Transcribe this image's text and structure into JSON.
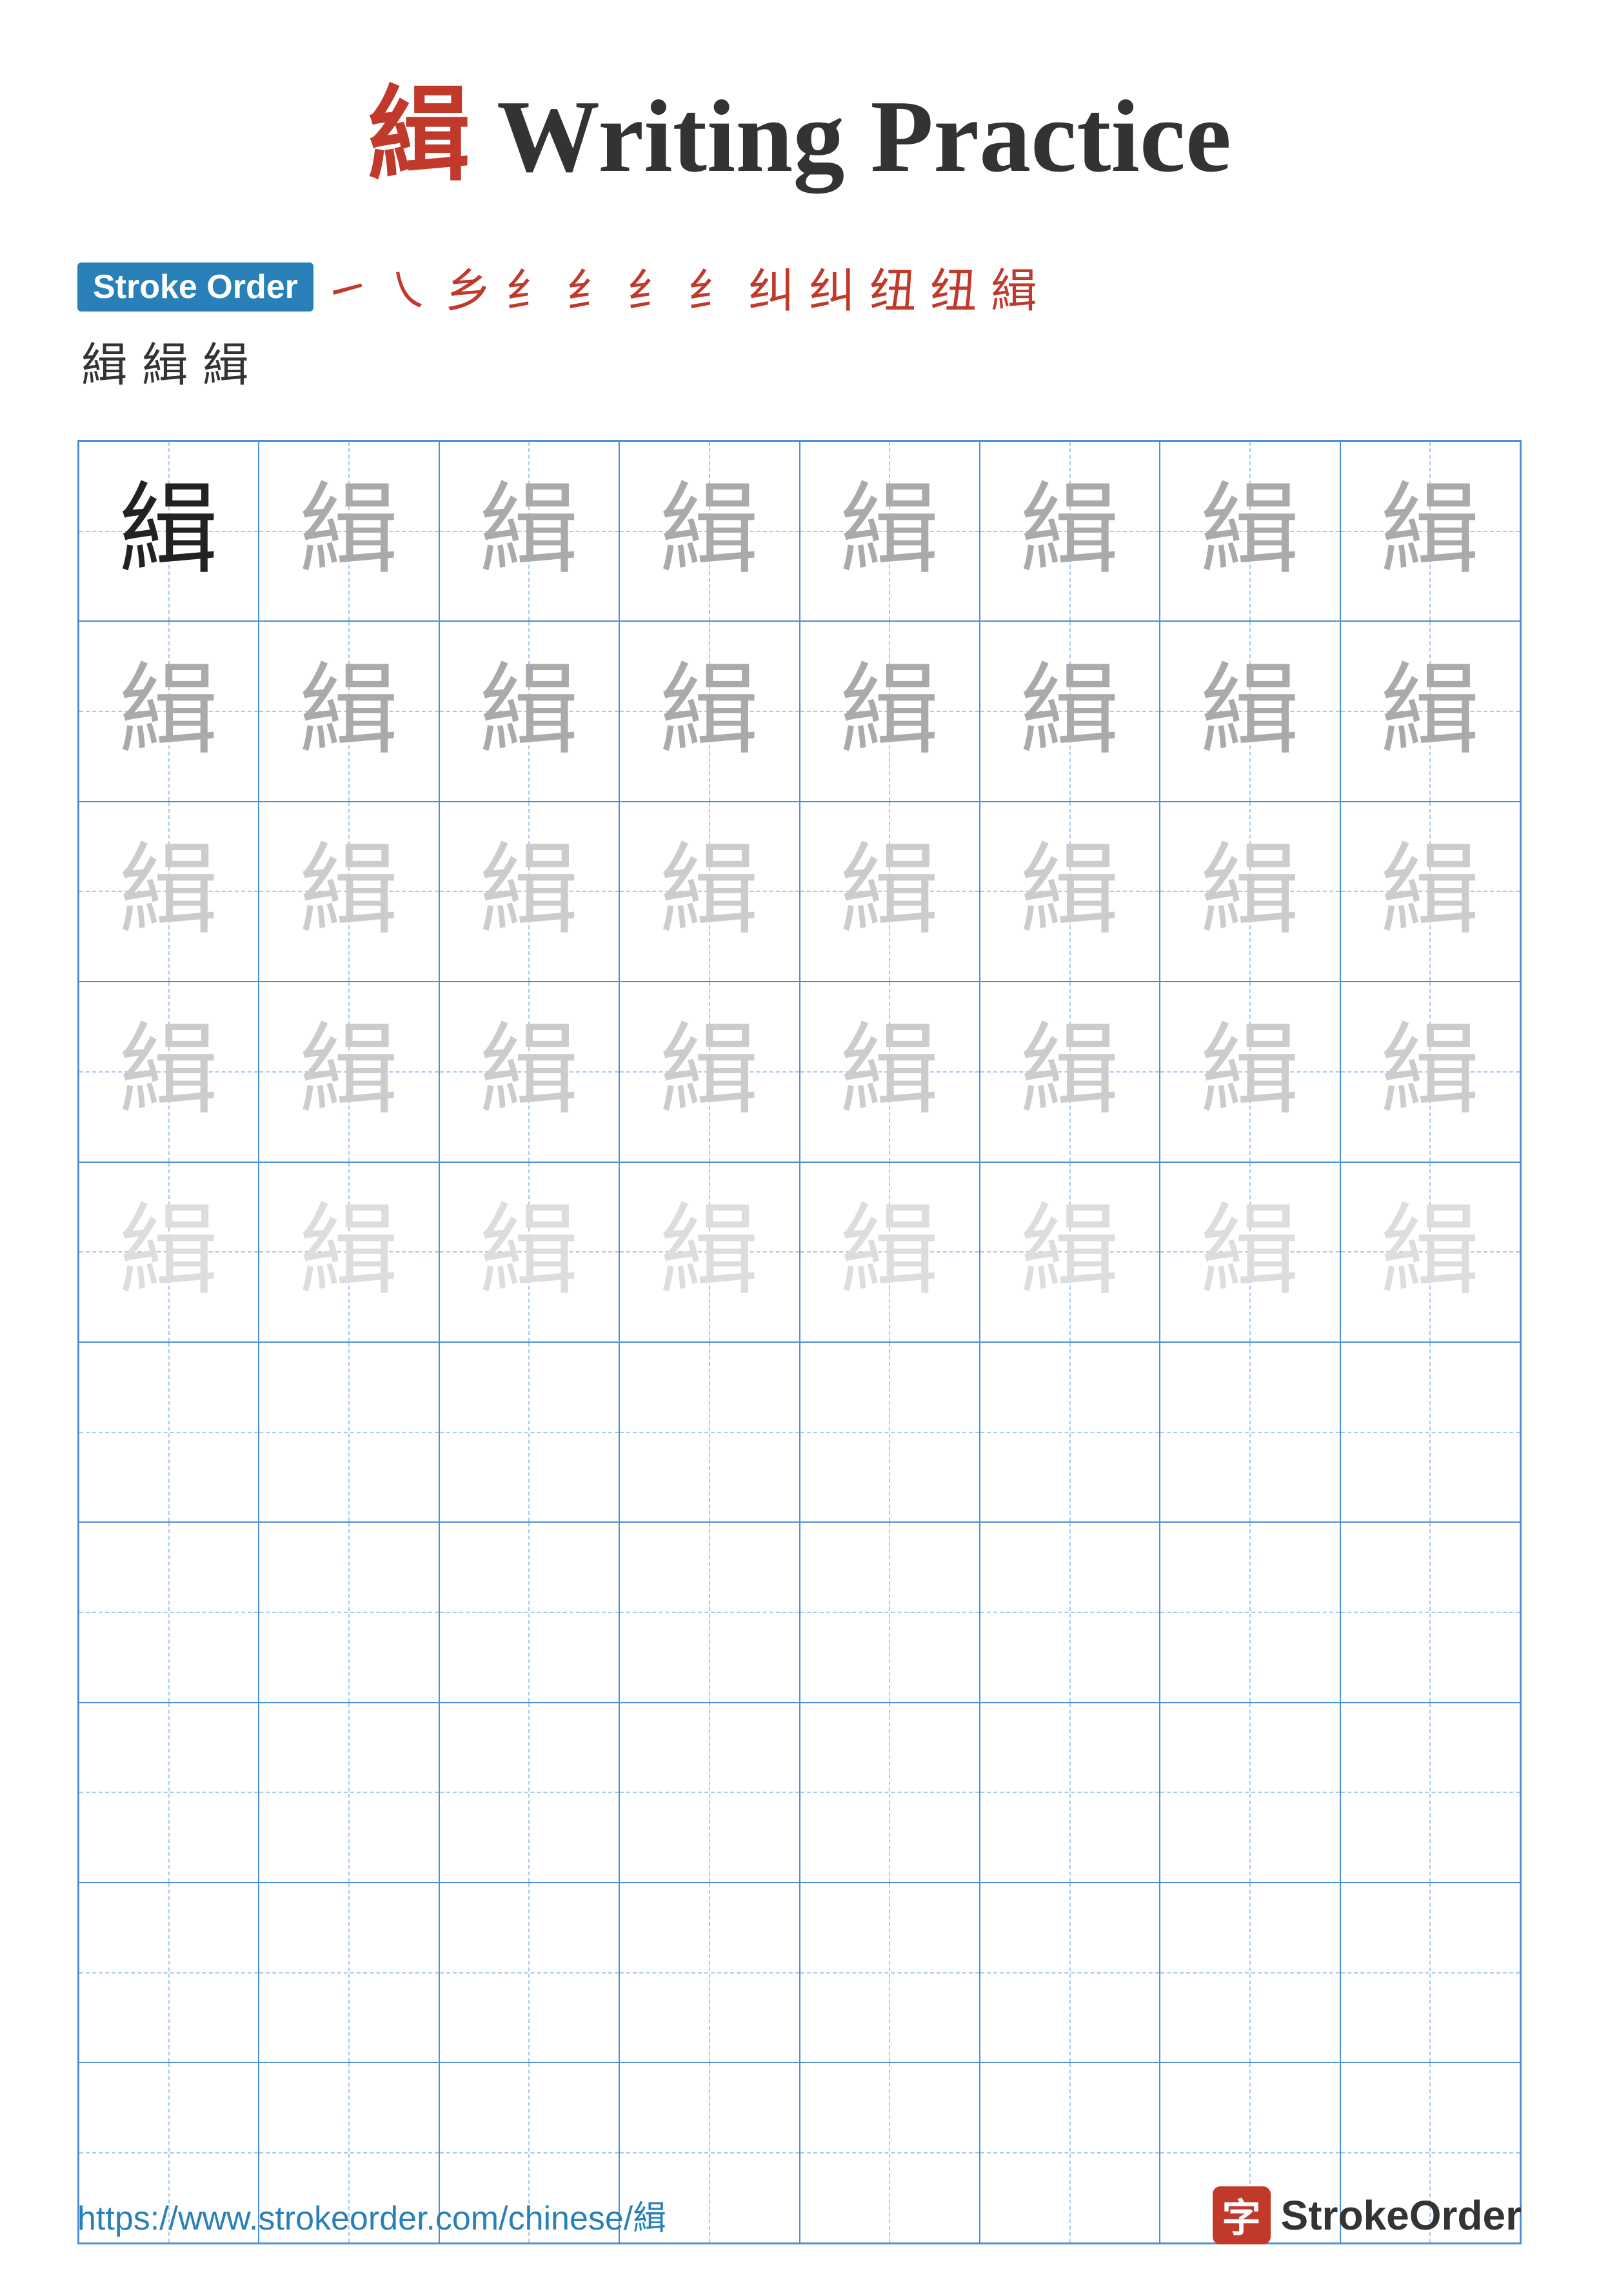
{
  "title": {
    "prefix_char": "緝",
    "suffix": " Writing Practice"
  },
  "stroke_order": {
    "badge_label": "Stroke Order",
    "stroke_chars": [
      "㇀",
      "㇏",
      "乡",
      "纟",
      "纟",
      "纟",
      "纟",
      "纠",
      "纠",
      "纽",
      "纽",
      "緝"
    ],
    "second_row_chars": [
      "緝",
      "緝",
      "緝"
    ]
  },
  "grid": {
    "rows": 10,
    "cols": 8,
    "character": "緝",
    "char_opacities": [
      [
        "dark",
        "medium",
        "medium",
        "medium",
        "medium",
        "medium",
        "medium",
        "medium"
      ],
      [
        "medium",
        "medium",
        "medium",
        "medium",
        "medium",
        "medium",
        "medium",
        "medium"
      ],
      [
        "light",
        "light",
        "light",
        "light",
        "light",
        "light",
        "light",
        "light"
      ],
      [
        "light",
        "light",
        "light",
        "light",
        "light",
        "light",
        "light",
        "light"
      ],
      [
        "very-light",
        "very-light",
        "very-light",
        "very-light",
        "very-light",
        "very-light",
        "very-light",
        "very-light"
      ],
      [
        "empty",
        "empty",
        "empty",
        "empty",
        "empty",
        "empty",
        "empty",
        "empty"
      ],
      [
        "empty",
        "empty",
        "empty",
        "empty",
        "empty",
        "empty",
        "empty",
        "empty"
      ],
      [
        "empty",
        "empty",
        "empty",
        "empty",
        "empty",
        "empty",
        "empty",
        "empty"
      ],
      [
        "empty",
        "empty",
        "empty",
        "empty",
        "empty",
        "empty",
        "empty",
        "empty"
      ],
      [
        "empty",
        "empty",
        "empty",
        "empty",
        "empty",
        "empty",
        "empty",
        "empty"
      ]
    ]
  },
  "footer": {
    "url": "https://www.strokeorder.com/chinese/緝",
    "brand_char": "字",
    "brand_name": "StrokeOrder"
  }
}
